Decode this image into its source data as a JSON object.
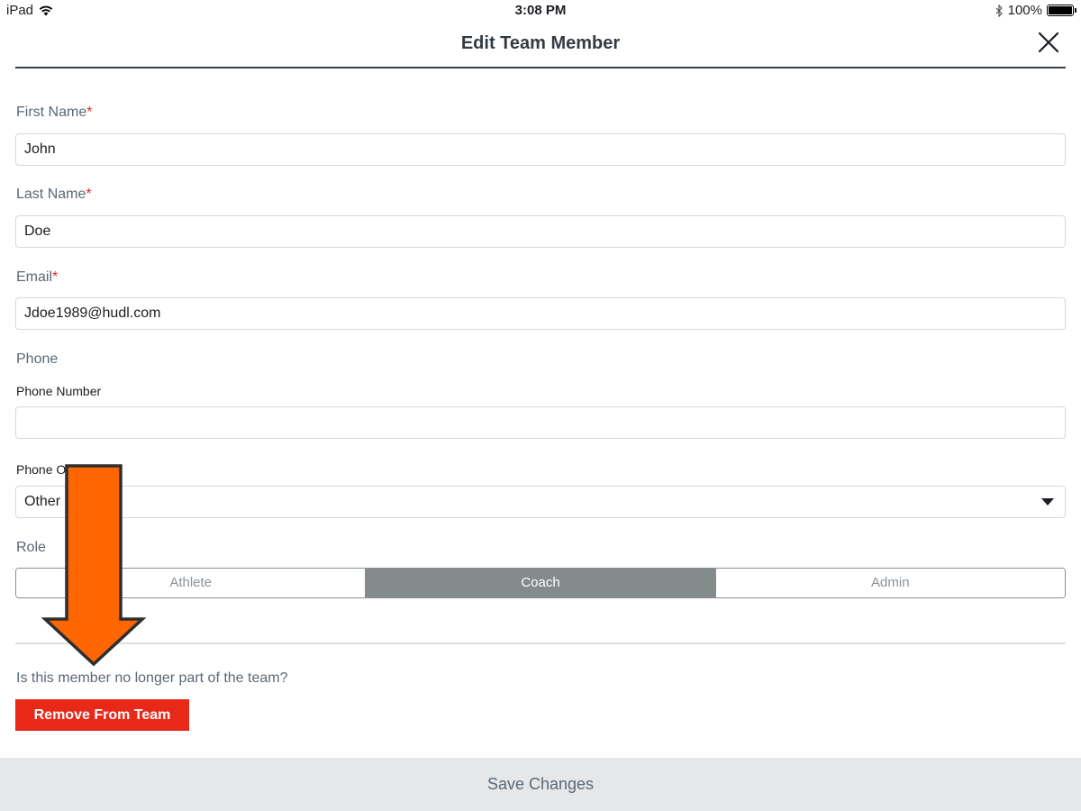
{
  "status_bar": {
    "device": "iPad",
    "time": "3:08 PM",
    "battery": "100%",
    "icons": {
      "wifi": "wifi-icon",
      "bluetooth": "bluetooth-icon",
      "battery": "battery-icon"
    }
  },
  "header": {
    "title": "Edit Team Member",
    "close_icon": "close-icon"
  },
  "form": {
    "first_name": {
      "label": "First Name",
      "required": "*",
      "value": "John"
    },
    "last_name": {
      "label": "Last Name",
      "required": "*",
      "value": "Doe"
    },
    "email": {
      "label": "Email",
      "required": "*",
      "value": "Jdoe1989@hudl.com"
    },
    "phone": {
      "section_label": "Phone",
      "number_label": "Phone Number",
      "number_value": "",
      "type_label": "Phone O",
      "type_value": "Other"
    },
    "role": {
      "label": "Role",
      "options": [
        "Athlete",
        "Coach",
        "Admin"
      ],
      "selected": "Coach"
    }
  },
  "remove": {
    "question": "Is this member no longer part of the team?",
    "button_label": "Remove From Team"
  },
  "footer": {
    "save_label": "Save Changes"
  },
  "colors": {
    "danger": "#e8291a",
    "segment_active": "#838b8b",
    "annotation_arrow": "#ff6600",
    "footer_bg": "#e5e7ea"
  },
  "annotation": {
    "arrow_icon": "arrow-down-icon"
  }
}
